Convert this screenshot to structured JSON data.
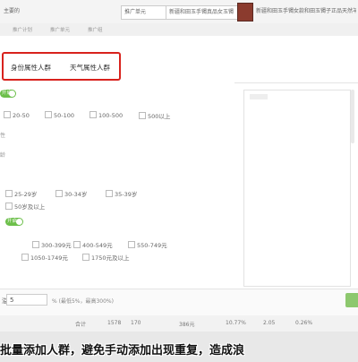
{
  "topbar": {
    "left_text": "主要的",
    "box1": "推广单元",
    "box2": "新疆和田玉手镯真品女",
    "box3": "新疆和田玉手镯真品女玉镯",
    "product_title": "新疆和田玉手镯女款和田玉镯子正品天然羊脂白玉"
  },
  "subbar": [
    "推广计划",
    "推广单元",
    "推广组"
  ],
  "tabs": [
    "身份属性人群",
    "天气属性人群"
  ],
  "toggles": [
    "开启",
    "开启"
  ],
  "age_options": [
    "20-50",
    "50-100",
    "100-500",
    "500以上"
  ],
  "age_group_options": [
    "25-29岁",
    "30-34岁",
    "35-39岁",
    "50岁及以上"
  ],
  "price_options": [
    "300-399元",
    "400-549元",
    "550-749元",
    "1050-1749元",
    "1750元及以上"
  ],
  "section_labels": [
    "性",
    "龄"
  ],
  "premium": {
    "prefix": "溢",
    "value": "5",
    "suffix": "% (最低5%，最高300%)"
  },
  "table_row": [
    "合计",
    "1578",
    "170",
    "386元",
    "10.77%",
    "2.05",
    "0.26%"
  ],
  "subtitle": "批量添加人群，避免手动添加出现重复，造成浪"
}
